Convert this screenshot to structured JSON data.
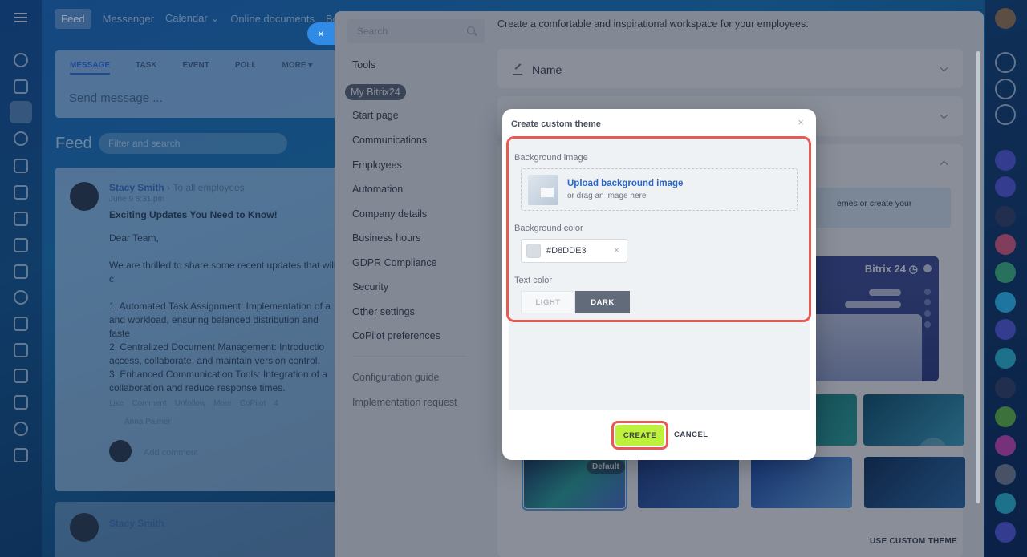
{
  "topnav": {
    "items": [
      "Feed",
      "Messenger",
      "Calendar ⌄",
      "Online documents",
      "Boa"
    ]
  },
  "post": {
    "tabs": [
      "MESSAGE",
      "TASK",
      "EVENT",
      "POLL",
      "MORE ▾"
    ],
    "placeholder": "Send message ..."
  },
  "feed": {
    "title": "Feed",
    "search_placeholder": "Filter and search",
    "post": {
      "author": "Stacy Smith",
      "audience": "To all employees",
      "date": "June 9 8:31 pm",
      "headline": "Exciting Updates You Need to Know!",
      "body": "Dear Team,\n\nWe are thrilled to share some recent updates that will c\n\n1. Automated Task Assignment: Implementation of a\nand workload, ensuring balanced distribution and faste\n2. Centralized Document Management: Introductio\naccess, collaborate, and maintain version control.\n3. Enhanced Communication Tools: Integration of a\ncollaboration and reduce response times.",
      "actions": [
        "Like",
        "Comment",
        "Unfollow",
        "More",
        "CoPilot",
        "4"
      ],
      "reactor": "Anna Palmer",
      "comment_placeholder": "Add comment"
    },
    "second_post_author": "Stacy Smith"
  },
  "settings": {
    "search_placeholder": "Search",
    "menu": [
      "Tools",
      "My Bitrix24",
      "Start page",
      "Communications",
      "Employees",
      "Automation",
      "Company details",
      "Business hours",
      "GDPR Compliance",
      "Security",
      "Other settings",
      "CoPilot preferences"
    ],
    "menu_footer": [
      "Configuration guide",
      "Implementation request"
    ],
    "intro": "Create a comfortable and inspirational workspace for your employees.",
    "name_section": "Name",
    "hint_text": "emes or create your",
    "preview_brand": "Bitrix 24 ◷",
    "default_badge": "Default",
    "use_custom_theme": "USE CUSTOM THEME"
  },
  "modal": {
    "title": "Create custom theme",
    "close": "×",
    "bg_image_label": "Background image",
    "upload_link": "Upload background image",
    "upload_sub": "or drag an image here",
    "bg_color_label": "Background color",
    "bg_color_value": "#D8DDE3",
    "clear": "×",
    "text_color_label": "Text color",
    "text_light": "LIGHT",
    "text_dark": "DARK",
    "create": "CREATE",
    "cancel": "CANCEL",
    "close_pill": "×"
  },
  "colors": {
    "accent": "#2a66c9",
    "create_button": "#bdf13c",
    "highlight": "#e85a52",
    "swatch": "#D8DDE3"
  }
}
